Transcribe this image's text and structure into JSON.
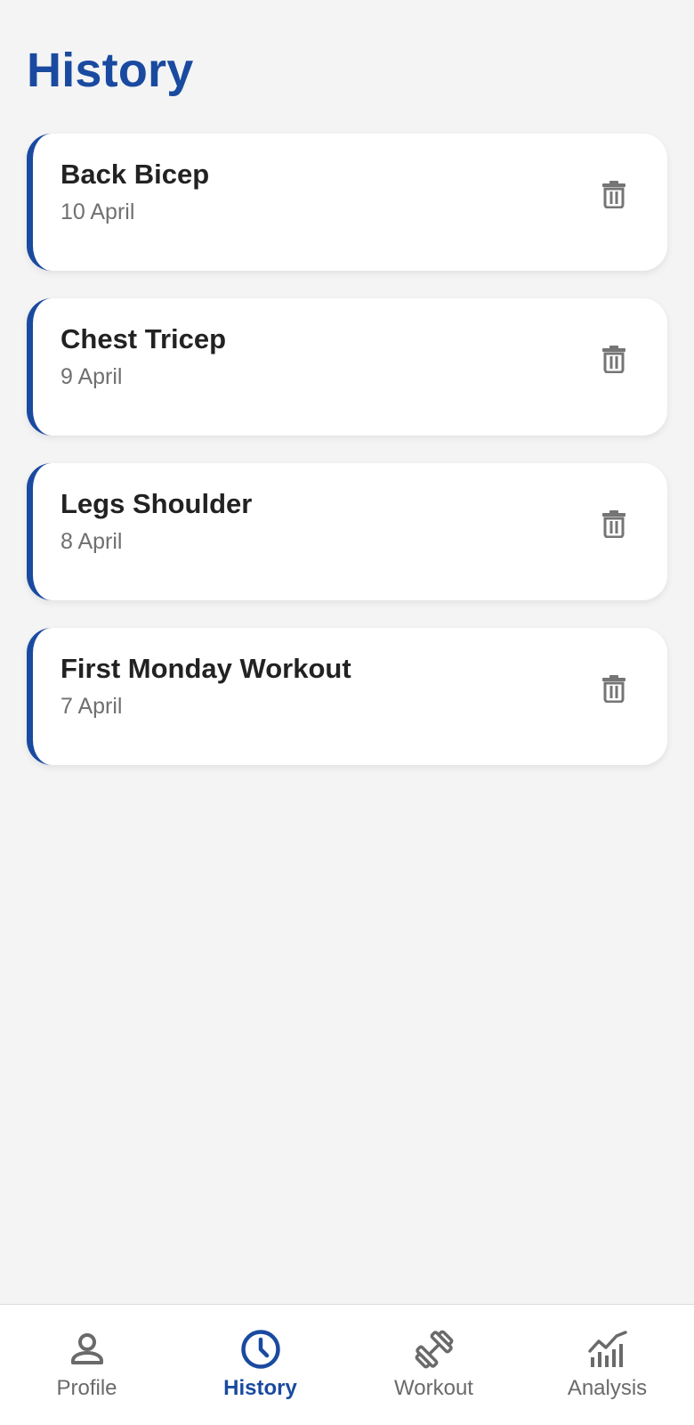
{
  "header": {
    "title": "History"
  },
  "history": {
    "items": [
      {
        "name": "Back Bicep",
        "date": "10 April"
      },
      {
        "name": "Chest Tricep",
        "date": "9 April"
      },
      {
        "name": "Legs Shoulder",
        "date": "8 April"
      },
      {
        "name": "First Monday Workout",
        "date": "7 April"
      }
    ],
    "delete_icon": "trash-icon"
  },
  "bottom_nav": {
    "items": [
      {
        "label": "Profile",
        "icon": "person-icon",
        "active": false
      },
      {
        "label": "History",
        "icon": "clock-icon",
        "active": true
      },
      {
        "label": "Workout",
        "icon": "dumbbell-icon",
        "active": false
      },
      {
        "label": "Analysis",
        "icon": "chart-icon",
        "active": false
      }
    ]
  },
  "colors": {
    "accent": "#1a4aa0",
    "background": "#f4f4f5",
    "card": "#ffffff",
    "text_primary": "#222222",
    "text_secondary": "#707070",
    "icon_inactive": "#6a6a6a"
  }
}
